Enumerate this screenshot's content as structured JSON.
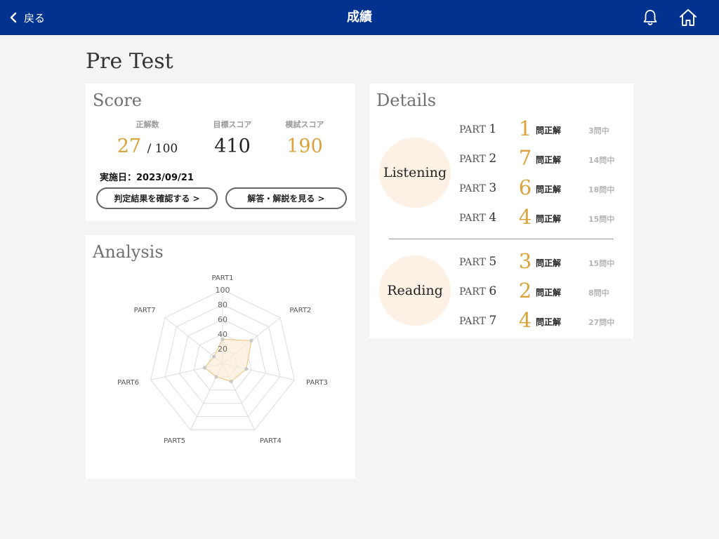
{
  "header": {
    "back_label": "戻る",
    "title": "成績",
    "bg_color": "#02328f",
    "icons": [
      "chevron-left-icon",
      "bell-icon",
      "home-icon"
    ]
  },
  "page_title": "Pre Test",
  "score": {
    "title": "Score",
    "correct_label": "正解数",
    "correct_value": "27",
    "correct_total": "/ 100",
    "target_label": "目標スコア",
    "target_value": "410",
    "mock_label": "模試スコア",
    "mock_value": "190",
    "date_text": "実施日：2023/09/21",
    "result_button": "判定結果を確認する >",
    "answers_button": "解答・解説を見る >",
    "accent_color": "#d9a23a"
  },
  "analysis": {
    "title": "Analysis"
  },
  "chart_data": {
    "type": "radar",
    "categories": [
      "PART1",
      "PART2",
      "PART3",
      "PART4",
      "PART5",
      "PART6",
      "PART7"
    ],
    "values": [
      33,
      50,
      33,
      27,
      20,
      25,
      15
    ],
    "rmin": 0,
    "rmax": 100,
    "ticks": [
      20,
      40,
      60,
      80,
      100
    ],
    "fill_color": "#fbeed9",
    "stroke_color": "#f0c98e",
    "point_color": "#c8c8c8",
    "grid": true
  },
  "details": {
    "title": "Details",
    "unit": "問正解",
    "sections": [
      {
        "name": "Listening",
        "parts": [
          {
            "label": "PART",
            "num": "1",
            "correct": "1",
            "total": "3問中"
          },
          {
            "label": "PART",
            "num": "2",
            "correct": "7",
            "total": "14問中"
          },
          {
            "label": "PART",
            "num": "3",
            "correct": "6",
            "total": "18問中"
          },
          {
            "label": "PART",
            "num": "4",
            "correct": "4",
            "total": "15問中"
          }
        ]
      },
      {
        "name": "Reading",
        "parts": [
          {
            "label": "PART",
            "num": "5",
            "correct": "3",
            "total": "15問中"
          },
          {
            "label": "PART",
            "num": "6",
            "correct": "2",
            "total": "8問中"
          },
          {
            "label": "PART",
            "num": "7",
            "correct": "4",
            "total": "27問中"
          }
        ]
      }
    ]
  }
}
